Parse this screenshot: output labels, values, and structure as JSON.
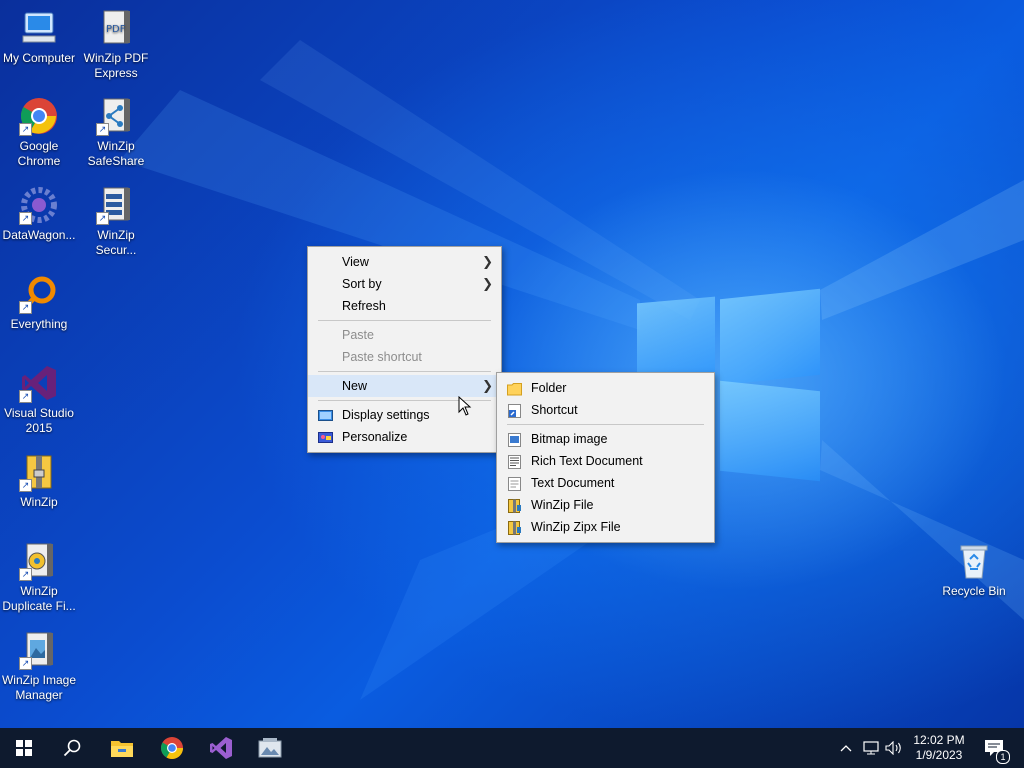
{
  "desktop": {
    "icons_left": [
      {
        "label": "My Computer",
        "icon": "computer-icon"
      },
      {
        "label": "Google Chrome",
        "icon": "chrome-icon"
      },
      {
        "label": "DataWagon...",
        "icon": "datawagon-icon"
      },
      {
        "label": "Everything",
        "icon": "everything-search-icon"
      },
      {
        "label": "Visual Studio 2015",
        "icon": "visual-studio-icon"
      },
      {
        "label": "WinZip",
        "icon": "winzip-icon"
      },
      {
        "label": "WinZip Duplicate Fi...",
        "icon": "winzip-duplicate-icon"
      },
      {
        "label": "WinZip Image Manager",
        "icon": "winzip-image-manager-icon"
      }
    ],
    "icons_second": [
      {
        "label": "WinZip PDF Express",
        "icon": "winzip-pdf-icon"
      },
      {
        "label": "WinZip SafeShare",
        "icon": "winzip-safeshare-icon"
      },
      {
        "label": "WinZip Secur...",
        "icon": "winzip-secure-icon"
      }
    ],
    "recycle_bin": {
      "label": "Recycle Bin",
      "icon": "recycle-bin-icon"
    }
  },
  "context_menu": {
    "items": [
      {
        "label": "View",
        "submenu": true
      },
      {
        "label": "Sort by",
        "submenu": true
      },
      {
        "label": "Refresh"
      },
      {
        "label": "Paste",
        "disabled": true
      },
      {
        "label": "Paste shortcut",
        "disabled": true
      },
      {
        "label": "New",
        "submenu": true,
        "highlighted": true
      },
      {
        "label": "Display settings",
        "icon": "display-icon"
      },
      {
        "label": "Personalize",
        "icon": "personalize-icon"
      }
    ]
  },
  "new_submenu": {
    "items": [
      {
        "label": "Folder",
        "icon": "folder-icon"
      },
      {
        "label": "Shortcut",
        "icon": "shortcut-icon"
      },
      {
        "label": "Bitmap image",
        "icon": "bitmap-icon"
      },
      {
        "label": "Rich Text Document",
        "icon": "rich-text-icon"
      },
      {
        "label": "Text Document",
        "icon": "text-document-icon"
      },
      {
        "label": "WinZip File",
        "icon": "winzip-file-icon"
      },
      {
        "label": "WinZip Zipx File",
        "icon": "winzip-zipx-icon"
      }
    ]
  },
  "taskbar": {
    "pinned": [
      "start-icon",
      "search-icon",
      "file-explorer-icon",
      "chrome-icon",
      "visual-studio-icon",
      "winzip-taskbar-icon"
    ],
    "time": "12:02 PM",
    "date": "1/9/2023",
    "notification_count": "1"
  },
  "colors": {
    "taskbar": "#0e1a2e",
    "menu_bg": "#f2f2f2",
    "menu_highlight": "#d9e7f8"
  }
}
